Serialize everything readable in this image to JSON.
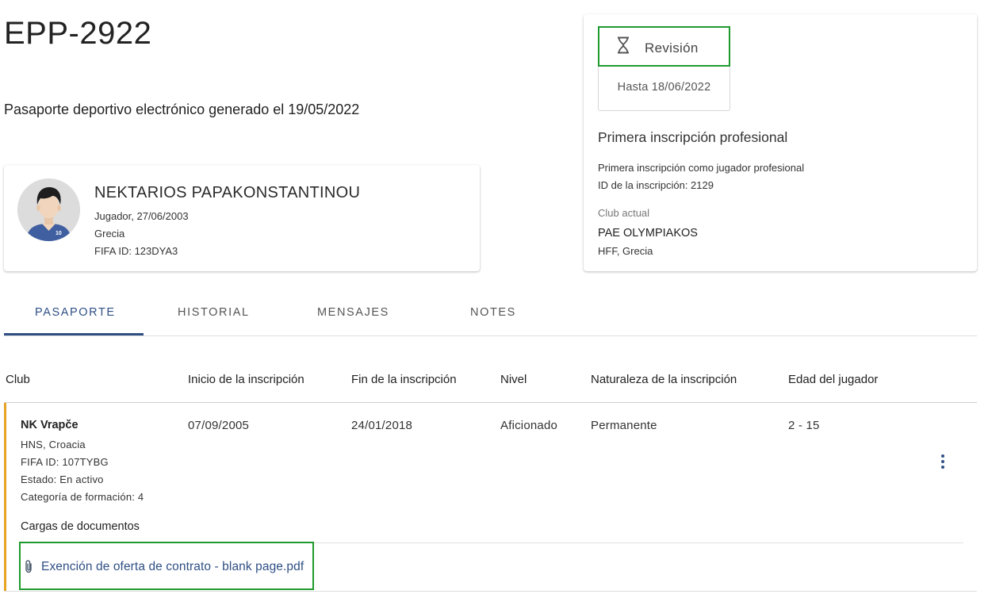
{
  "header": {
    "title": "EPP-2922",
    "subtitle": "Pasaporte deportivo electrónico generado el 19/05/2022"
  },
  "player": {
    "name": "NEKTARIOS PAPAKONSTANTINOU",
    "role_birth": "Jugador, 27/06/2003",
    "country": "Grecia",
    "fifa_id": "FIFA ID: 123DYA3",
    "jersey_number": "10"
  },
  "status": {
    "label": "Revisión",
    "icon": "hourglass-icon",
    "until": "Hasta 18/06/2022",
    "registration_title": "Primera inscripción profesional",
    "registration_desc": "Primera inscripción como jugador profesional",
    "registration_id": "ID de la inscripción: 2129",
    "current_club_label": "Club actual",
    "current_club": "PAE OLYMPIAKOS",
    "current_club_assoc": "HFF, Grecia"
  },
  "tabs": [
    {
      "label": "PASAPORTE",
      "active": true
    },
    {
      "label": "HISTORIAL",
      "active": false
    },
    {
      "label": "MENSAJES",
      "active": false
    },
    {
      "label": "NOTES",
      "active": false
    }
  ],
  "table": {
    "headers": [
      "Club",
      "Inicio de la inscripción",
      "Fin de la inscripción",
      "Nivel",
      "Naturaleza de la inscripción",
      "Edad del jugador"
    ],
    "rows": [
      {
        "club": "NK Vrapče",
        "association": "HNS, Croacia",
        "fifa_id": "FIFA ID: 107TYBG",
        "state": "Estado: En activo",
        "training_category": "Categoría de formación: 4",
        "start": "07/09/2005",
        "end": "24/01/2018",
        "level": "Aficionado",
        "nature": "Permanente",
        "age": "2 - 15",
        "documents_title": "Cargas de documentos",
        "documents": [
          {
            "name": "Exención de oferta de contrato - blank page.pdf",
            "icon": "paperclip-icon"
          }
        ]
      }
    ]
  },
  "colors": {
    "accent": "#2f4f85",
    "highlight_border": "#1f9a2e",
    "row_accent": "#e6a324"
  }
}
